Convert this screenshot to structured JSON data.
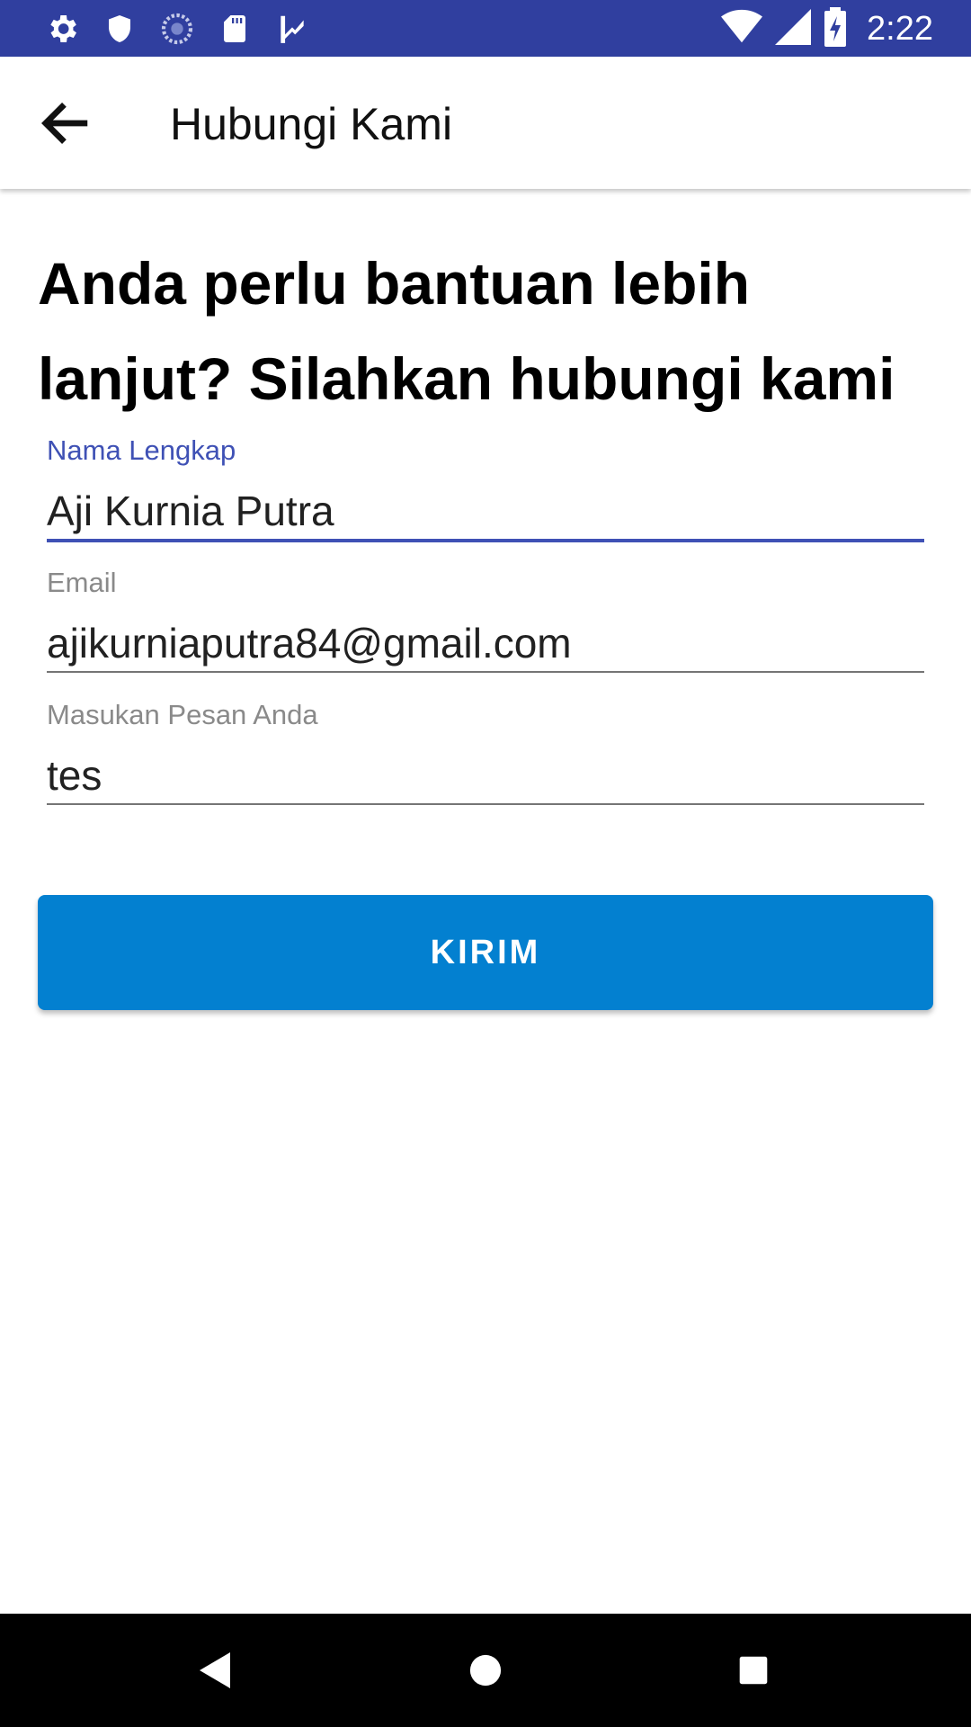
{
  "status_bar": {
    "time": "2:22",
    "bg_color": "#303f9f",
    "left_icons": [
      "settings-icon",
      "shield-icon",
      "sync-icon",
      "sd-card-icon",
      "task-icon"
    ],
    "right_icons": [
      "wifi-icon",
      "signal-icon",
      "battery-charging-icon"
    ]
  },
  "app_bar": {
    "title": "Hubungi Kami",
    "back_icon": "arrow-back-icon"
  },
  "heading": "Anda perlu bantuan lebih lanjut? Silahkan hubungi kami",
  "form": {
    "name": {
      "label": "Nama Lengkap",
      "value": "Aji Kurnia Putra"
    },
    "email": {
      "label": "Email",
      "value": "ajikurniaputra84@gmail.com"
    },
    "message": {
      "label": "Masukan Pesan Anda",
      "value": "tes"
    }
  },
  "submit_label": "KIRIM",
  "colors": {
    "accent": "#3f51b5",
    "button": "#0380d0"
  },
  "nav_bar": {
    "icons": [
      "back-triangle-icon",
      "home-circle-icon",
      "recents-square-icon"
    ]
  }
}
